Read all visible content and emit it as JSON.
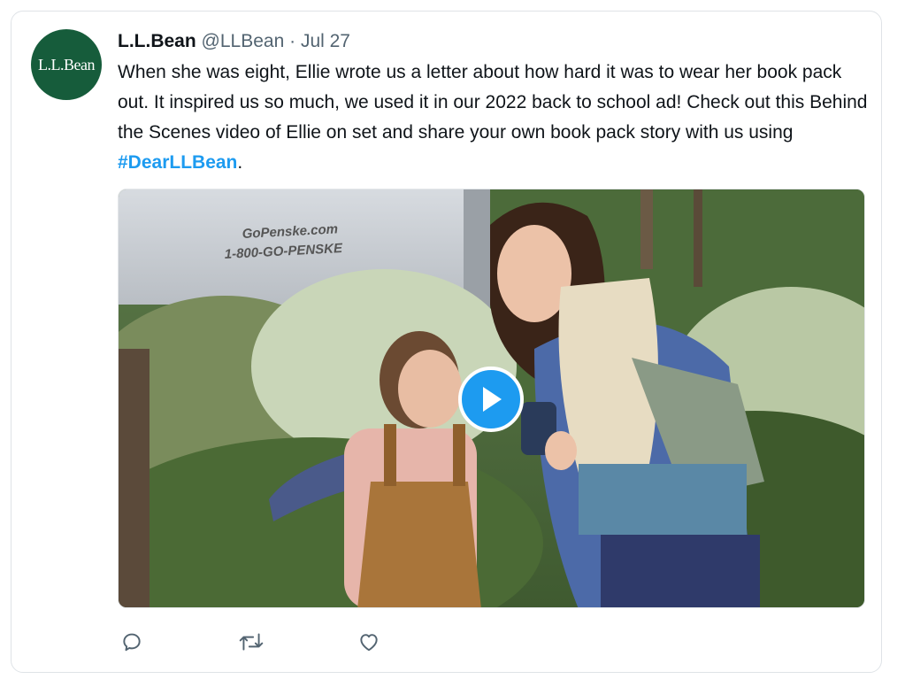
{
  "tweet": {
    "author_name": "L.L.Bean",
    "author_handle": "@LLBean",
    "separator": "·",
    "date": "Jul 27",
    "avatar_text": "L.L.Bean",
    "text_before_hashtag": "When she was eight, Ellie wrote us a letter about how hard it was to wear her book pack out. It inspired us so much, we used it in our 2022 back to school ad! Check out this Behind the Scenes video of Ellie on set and share your own book pack story with us using ",
    "hashtag": "#DearLLBean",
    "text_after_hashtag": "."
  },
  "media": {
    "truck_text_line1": "GoPenske.com",
    "truck_text_line2": "1-800-GO-PENSKE"
  },
  "actions": [
    {
      "icon": "reply-icon"
    },
    {
      "icon": "retweet-icon"
    },
    {
      "icon": "like-icon"
    }
  ],
  "colors": {
    "accent": "#1d9bf0",
    "avatar_bg": "#165c3b",
    "secondary_text": "#536471"
  }
}
